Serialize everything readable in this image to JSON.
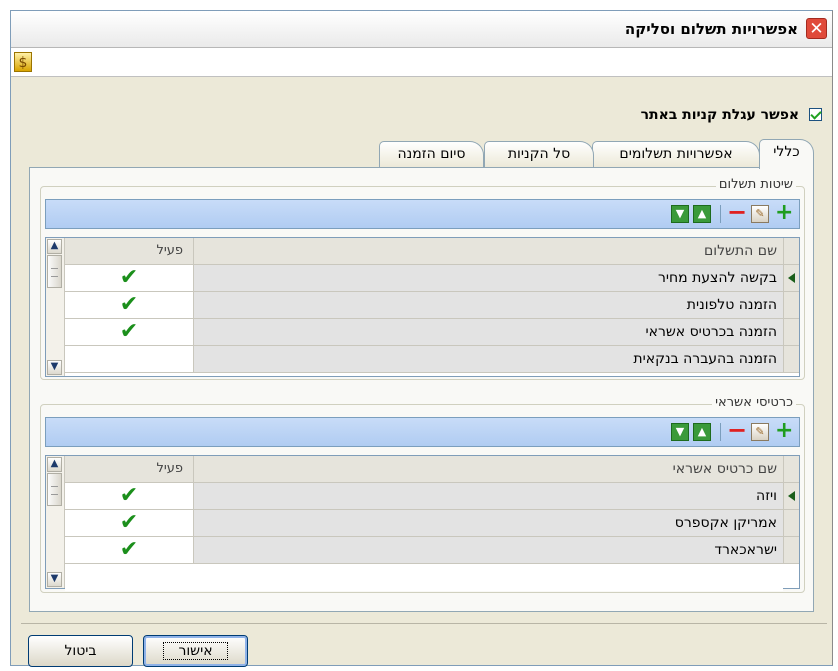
{
  "window": {
    "title": "אפשרויות תשלום וסליקה"
  },
  "settings": {
    "enable_cart_label": "אפשר עגלת קניות באתר",
    "enable_cart_checked": true
  },
  "tabs": [
    {
      "label": "כללי",
      "active": true
    },
    {
      "label": "אפשרויות תשלומים",
      "active": false
    },
    {
      "label": "סל הקניות",
      "active": false
    },
    {
      "label": "סיום הזמנה",
      "active": false
    }
  ],
  "payment_methods": {
    "legend": "שיטות תשלום",
    "headers": {
      "name": "שם התשלום",
      "active": "פעיל"
    },
    "rows": [
      {
        "name": "בקשה להצעת מחיר",
        "active": true,
        "current": true
      },
      {
        "name": "הזמנה טלפונית",
        "active": true
      },
      {
        "name": "הזמנה בכרטיס אשראי",
        "active": true
      },
      {
        "name": "הזמנה בהעברה בנקאית",
        "active": false
      }
    ]
  },
  "credit_cards": {
    "legend": "כרטיסי אשראי",
    "headers": {
      "name": "שם כרטיס אשראי",
      "active": "פעיל"
    },
    "rows": [
      {
        "name": "ויזה",
        "active": true,
        "current": true
      },
      {
        "name": "אמריקן אקספרס",
        "active": true
      },
      {
        "name": "ישראכארד",
        "active": true
      }
    ]
  },
  "icons": {
    "add": "plus-icon",
    "remove": "minus-icon",
    "edit": "edit-icon",
    "up": "arrow-up-icon",
    "down": "arrow-down-icon",
    "check": "check-icon",
    "toolbar": "app-toolbar-icon",
    "close": "close-icon"
  },
  "buttons": {
    "ok": "אישור",
    "cancel": "ביטול"
  },
  "colors": {
    "accent": "#7b9ebd",
    "tick": "#1b8f1b",
    "remove": "#e02020",
    "close": "#e04a3a"
  }
}
